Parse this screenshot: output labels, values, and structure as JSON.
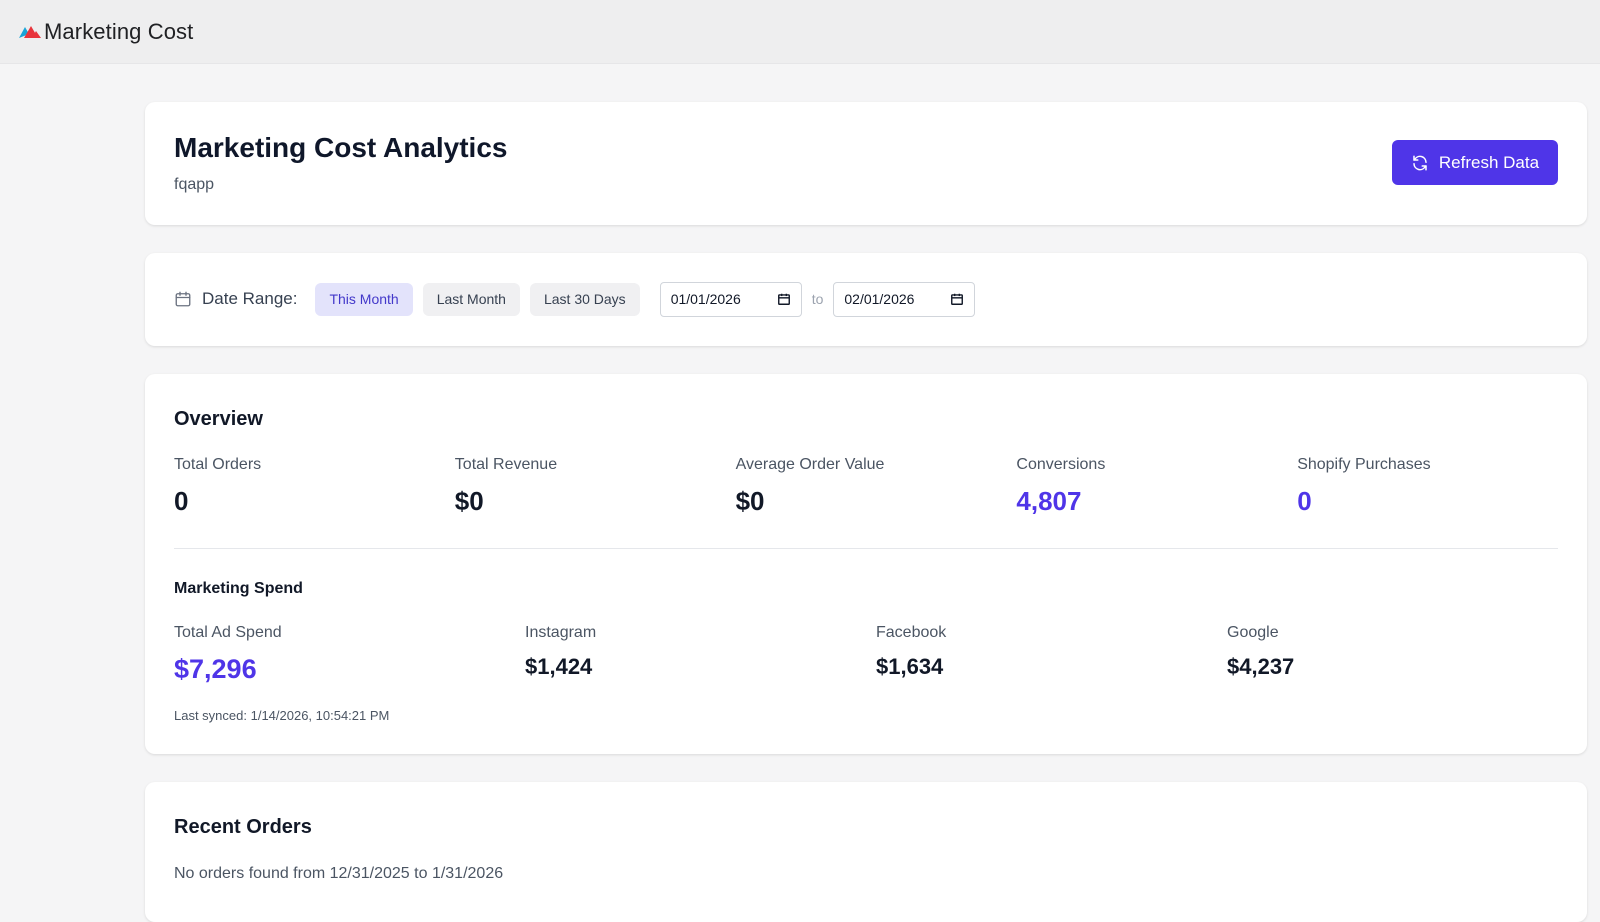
{
  "topbar": {
    "app_title": "Marketing Cost",
    "logo_icon": "mountain-logo-icon"
  },
  "header": {
    "title": "Marketing Cost Analytics",
    "subtitle": "fqapp",
    "refresh_label": "Refresh Data",
    "refresh_icon": "refresh-icon"
  },
  "date_range": {
    "label": "Date Range:",
    "icon": "calendar-icon",
    "presets": [
      {
        "label": "This Month",
        "active": true
      },
      {
        "label": "Last Month",
        "active": false
      },
      {
        "label": "Last 30 Days",
        "active": false
      }
    ],
    "start_date": "01/01/2026",
    "end_date": "02/01/2026",
    "to_label": "to"
  },
  "overview": {
    "title": "Overview",
    "stats": [
      {
        "label": "Total Orders",
        "value": "0"
      },
      {
        "label": "Total Revenue",
        "value": "$0"
      },
      {
        "label": "Average Order Value",
        "value": "$0"
      },
      {
        "label": "Conversions",
        "value": "4,807"
      },
      {
        "label": "Shopify Purchases",
        "value": "0"
      }
    ],
    "marketing_spend": {
      "title": "Marketing Spend",
      "items": [
        {
          "label": "Total Ad Spend",
          "value": "$7,296"
        },
        {
          "label": "Instagram",
          "value": "$1,424"
        },
        {
          "label": "Facebook",
          "value": "$1,634"
        },
        {
          "label": "Google",
          "value": "$4,237"
        }
      ],
      "last_synced": "Last synced: 1/14/2026, 10:54:21 PM"
    }
  },
  "recent_orders": {
    "title": "Recent Orders",
    "empty_message": "No orders found from 12/31/2025 to 1/31/2026"
  },
  "colors": {
    "accent": "#4f35e8",
    "active_preset_bg": "#e3e3fb",
    "page_bg": "#f5f5f6"
  }
}
